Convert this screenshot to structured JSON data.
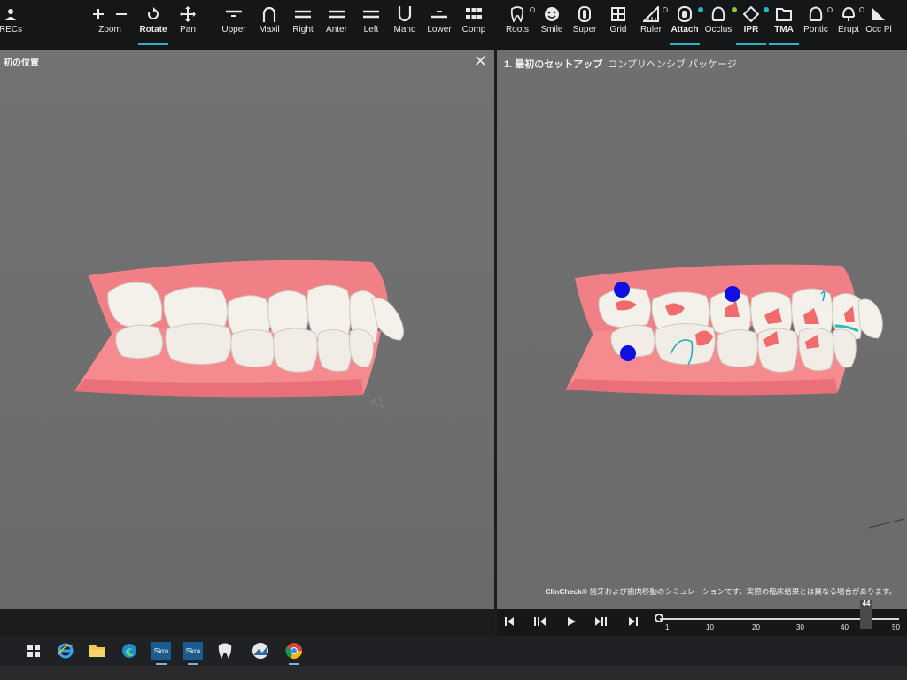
{
  "toolbar": {
    "items": [
      {
        "label": "RECs",
        "icon": "user-icon"
      },
      {
        "label": "Zoom",
        "icon": "zoom-icon"
      },
      {
        "label": "Rotate",
        "icon": "rotate-icon",
        "active": true
      },
      {
        "label": "Pan",
        "icon": "pan-icon"
      },
      {
        "label": "Upper",
        "icon": "upper-view-icon"
      },
      {
        "label": "Maxil",
        "icon": "maxillary-arch-icon"
      },
      {
        "label": "Right",
        "icon": "right-view-icon"
      },
      {
        "label": "Anter",
        "icon": "anterior-view-icon"
      },
      {
        "label": "Left",
        "icon": "left-view-icon"
      },
      {
        "label": "Mand",
        "icon": "mandibular-arch-icon"
      },
      {
        "label": "Lower",
        "icon": "lower-view-icon"
      },
      {
        "label": "Comp",
        "icon": "compare-grid-icon"
      },
      {
        "label": "Roots",
        "icon": "tooth-root-icon"
      },
      {
        "label": "Smile",
        "icon": "smile-icon"
      },
      {
        "label": "Super",
        "icon": "superimpose-icon"
      },
      {
        "label": "Grid",
        "icon": "grid-icon"
      },
      {
        "label": "Ruler",
        "icon": "ruler-icon"
      },
      {
        "label": "Attach",
        "icon": "attachment-icon",
        "active": true
      },
      {
        "label": "Occlus",
        "icon": "occlusion-icon"
      },
      {
        "label": "IPR",
        "icon": "ipr-icon",
        "active": true
      },
      {
        "label": "TMA",
        "icon": "folder-icon",
        "active": true
      },
      {
        "label": "Pontic",
        "icon": "pontic-icon"
      },
      {
        "label": "Erupt",
        "icon": "eruption-icon"
      },
      {
        "label": "Occ Pl",
        "icon": "occlusal-plane-icon"
      }
    ]
  },
  "left_panel": {
    "title": "初の位置",
    "close_symbol": "✕"
  },
  "right_panel": {
    "title_bold": "1. 最初のセットアップ",
    "title_rest": "コンプリヘンシブ パッケージ",
    "disclaimer_brand": "ClinCheck®",
    "disclaimer_text": "歯牙および歯肉移動のシミュレーションです。実際の臨床結果とは異なる場合があります。"
  },
  "player": {
    "ticks": [
      "1",
      "10",
      "20",
      "30",
      "40",
      "50"
    ],
    "current_stage": "44",
    "stage_position_fraction": 0.86
  },
  "taskbar": {
    "apps": [
      "windows-start-icon",
      "internet-explorer-icon",
      "file-explorer-icon",
      "edge-browser-icon",
      "skra-app-icon",
      "skra-app-icon-2",
      "tooth-app-icon",
      "photos-app-icon",
      "chrome-browser-icon"
    ],
    "skra_label": "Skra"
  },
  "colors": {
    "attachment_marker": "#1010e0",
    "gum": "#f07f86",
    "tooth": "#f3f0ea",
    "accent": "#2fb2c8"
  }
}
